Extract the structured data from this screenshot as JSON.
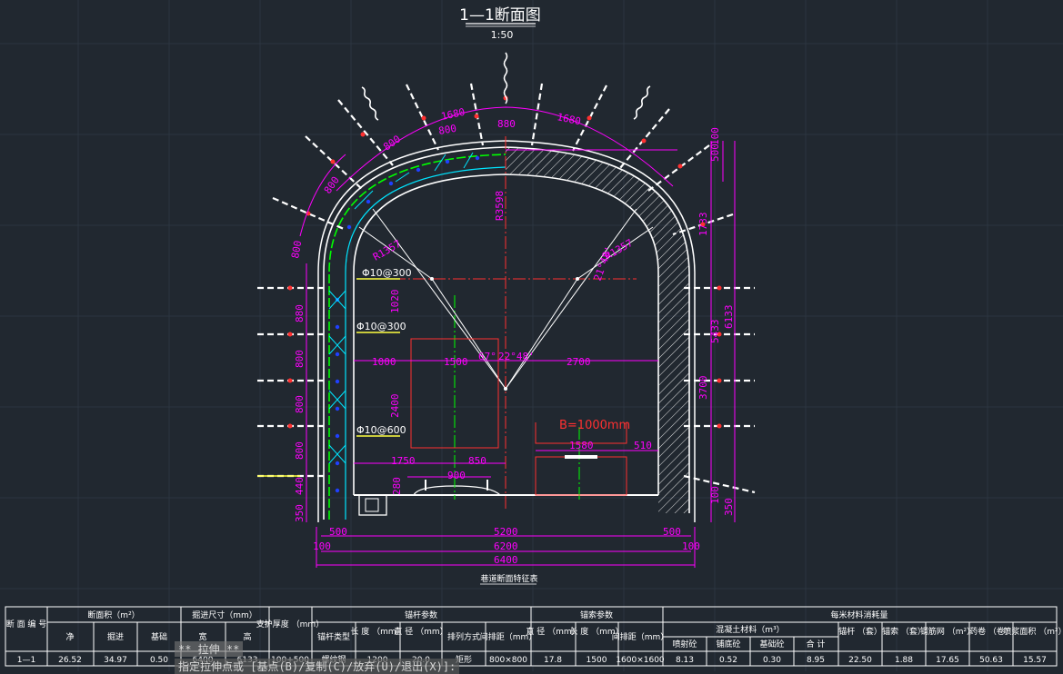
{
  "drawing": {
    "title": "1—1断面图",
    "scale": "1:50",
    "caption": "巷道断面特征表"
  },
  "dims": {
    "arc_1680_left": "1680",
    "arc_1680_right": "1680",
    "arc_800_top_left": "800",
    "arc_800_top_right": "880",
    "arc_800_mid_left": "800",
    "arc_800_upper_left": "800",
    "arc_800_left_side": "800",
    "side_880": "880",
    "side_800_a": "800",
    "side_800_b": "800",
    "side_800_c": "800",
    "side_440": "440",
    "side_350": "350",
    "r3598": "R3598",
    "r1357_left": "R1357",
    "r1357_right": "R1357",
    "r21": "21°48'",
    "a67": "67°",
    "a22": "22°48'",
    "phi_300_a": "Φ10@300",
    "phi_300_b": "Φ10@300",
    "phi_600": "Φ10@600",
    "d1020": "1020",
    "d2400": "2400",
    "d1000": "1000",
    "d1500": "1500",
    "d2700": "2700",
    "d1750": "1750",
    "d850": "850",
    "d900": "900",
    "d280": "280",
    "d1580": "1580",
    "d510": "510",
    "b_label": "B=1000mm",
    "d500_left": "500",
    "d5200": "5200",
    "d500_right": "500",
    "d100_left": "100",
    "d6200": "6200",
    "d100_right": "100",
    "d6400": "6400",
    "r500": "500",
    "r100": "100",
    "r1733": "1733",
    "r5433": "5433",
    "r6133": "6133",
    "r3700": "3700",
    "r100b": "100",
    "r350": "350"
  },
  "table": {
    "headers_top": [
      "断 面\n编 号",
      "断面积（m²）",
      "掘进尺寸（mm）",
      "支护厚度\n（mm）",
      "锚杆参数",
      "锚索参数",
      "每米材料消耗量"
    ],
    "sub1": [
      "净",
      "掘进",
      "基础",
      "宽",
      "高"
    ],
    "bolt_sub": [
      "锚杆类型",
      "长 度\n（mm）",
      "直 径\n（mm）",
      "排列方式",
      "间排距（mm）"
    ],
    "cable_sub": [
      "直 径\n（mm）",
      "长 度\n（mm）",
      "间排距（mm）"
    ],
    "material_group": "混凝土材料（m³）",
    "material_sub": [
      "喷射砼",
      "铺底砼",
      "基础砼",
      "合 计"
    ],
    "material_rest": [
      "锚杆\n（套）",
      "锚索\n（套）",
      "钢筋网\n（m²）",
      "药卷\n（卷）",
      "喷浆面积\n（m²）"
    ],
    "row": [
      "1—1",
      "26.52",
      "34.97",
      "0.50",
      "6400",
      "6133",
      "100+500",
      "螺纹钢",
      "1200",
      "20.0",
      "矩形",
      "800×800",
      "17.8",
      "1500",
      "1600×1600",
      "8.13",
      "0.52",
      "0.30",
      "8.95",
      "22.50",
      "1.88",
      "17.65",
      "50.63",
      "15.57"
    ]
  },
  "command": {
    "line1": "** 拉伸 **",
    "line2": "指定拉伸点或 [基点(B)/复制(C)/放弃(U)/退出(X)]:"
  },
  "colors": {
    "background": "#212830",
    "dimension": "#ff00ff",
    "outline": "#ffffff",
    "center": "#ff3030",
    "mesh": "#00e5ff",
    "green": "#00ff00"
  }
}
